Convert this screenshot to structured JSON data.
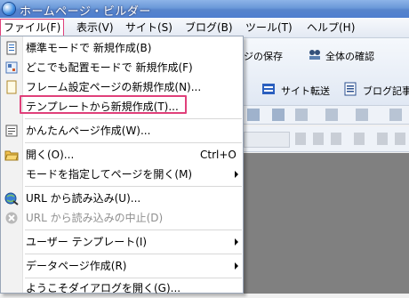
{
  "title_bar": {
    "title": "ホームページ・ビルダー"
  },
  "menubar": [
    {
      "label": "ファイル(F)",
      "open": true
    },
    {
      "label": "表示(V)"
    },
    {
      "label": "サイト(S)"
    },
    {
      "label": "ブログ(B)"
    },
    {
      "label": "ツール(T)"
    },
    {
      "label": "ヘルプ(H)"
    }
  ],
  "background_toolbar": {
    "save_page_fragment": "ジの保存",
    "check_all": "全体の確認",
    "site_transfer": "サイト転送",
    "blog_article_fragment": "ブログ記事"
  },
  "file_menu": {
    "items": [
      {
        "label": "標準モードで 新規作成(B)",
        "icon": "new-document-icon"
      },
      {
        "label": "どこでも配置モードで 新規作成(F)",
        "icon": "anywhere-layout-icon"
      },
      {
        "label": "フレーム設定ページの新規作成(N)...",
        "icon": "frame-page-icon"
      },
      {
        "label": "テンプレートから新規作成(T)...",
        "icon": "",
        "highlighted": true
      },
      {
        "label": "かんたんページ作成(W)...",
        "icon": "easy-page-icon"
      },
      {
        "label": "開く(O)...",
        "icon": "open-folder-icon",
        "shortcut": "Ctrl+O"
      },
      {
        "label": "モードを指定してページを開く(M)",
        "submenu": true
      },
      {
        "label": "URL から読み込み(U)...",
        "icon": "url-globe-icon"
      },
      {
        "label": "URL から読み込みの中止(D)",
        "icon": "stop-icon",
        "disabled": true
      },
      {
        "label": "ユーザー テンプレート(I)",
        "submenu": true
      },
      {
        "label": "データページ作成(R)",
        "submenu": true
      },
      {
        "label": "ようこそダイアログを開く(G)..."
      }
    ]
  },
  "colors": {
    "highlight_border": "#e0407a",
    "titlebar": "#5684cc"
  }
}
